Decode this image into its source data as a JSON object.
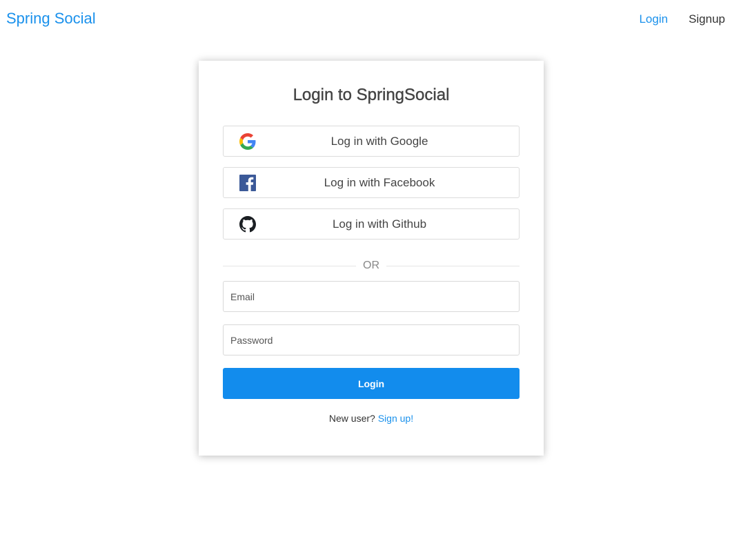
{
  "navbar": {
    "brand": "Spring Social",
    "links": [
      {
        "label": "Login",
        "active": true
      },
      {
        "label": "Signup",
        "active": false
      }
    ]
  },
  "login_card": {
    "title": "Login to SpringSocial",
    "social": [
      {
        "label": "Log in with Google",
        "icon": "google-icon"
      },
      {
        "label": "Log in with Facebook",
        "icon": "facebook-icon"
      },
      {
        "label": "Log in with Github",
        "icon": "github-icon"
      }
    ],
    "divider": "OR",
    "email": {
      "placeholder": "Email",
      "value": ""
    },
    "password": {
      "placeholder": "Password",
      "value": ""
    },
    "submit_label": "Login",
    "signup_prompt": "New user?",
    "signup_link": "Sign up!"
  },
  "colors": {
    "accent": "#1a91ec",
    "button": "#128ced",
    "facebook": "#3b5998",
    "github": "#1b1f23"
  }
}
